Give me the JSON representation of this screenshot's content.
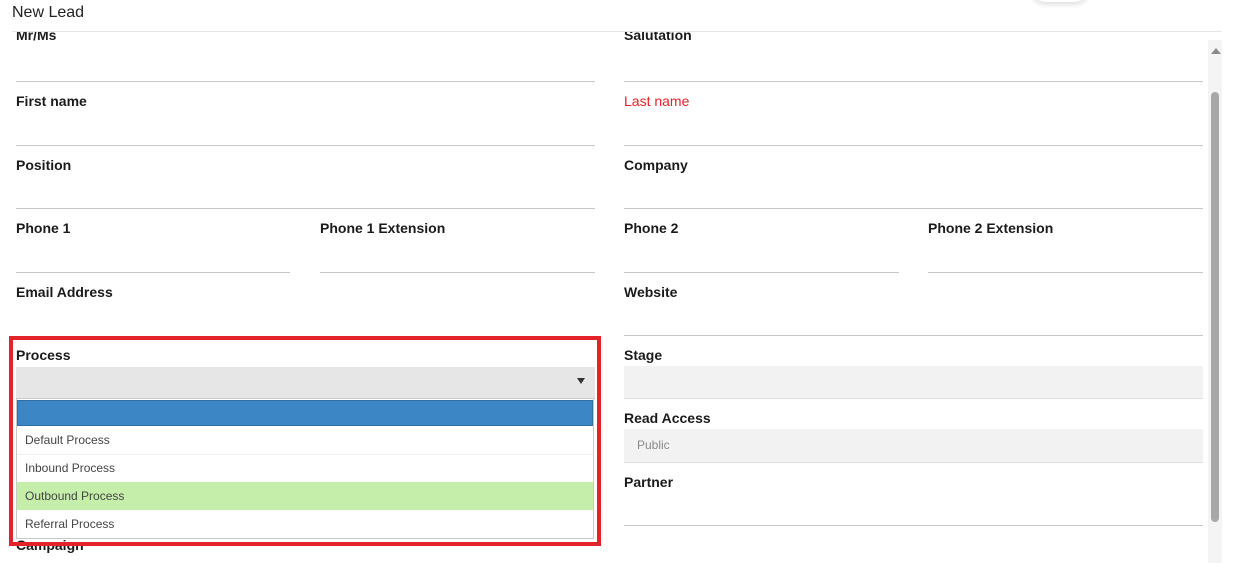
{
  "window": {
    "title": "New Lead"
  },
  "form": {
    "mr_ms_label": "Mr/Ms",
    "salutation_label": "Salutation",
    "first_name_label": "First name",
    "last_name_label": "Last name",
    "position_label": "Position",
    "company_label": "Company",
    "phone1_label": "Phone 1",
    "phone1_ext_label": "Phone 1 Extension",
    "phone2_label": "Phone 2",
    "phone2_ext_label": "Phone 2 Extension",
    "email_label": "Email Address",
    "website_label": "Website",
    "process_label": "Process",
    "stage_label": "Stage",
    "read_access_label": "Read Access",
    "read_access_value": "Public",
    "partner_label": "Partner",
    "campaign_label": "Campaign"
  },
  "process_dropdown": {
    "selected": "",
    "options": [
      "",
      "Default Process",
      "Inbound Process",
      "Outbound Process",
      "Referral Process"
    ],
    "highlighted": "Outbound Process"
  },
  "colors": {
    "required_label": "#e8212b",
    "dropdown_selected": "#3d86c6",
    "dropdown_hover": "#c5eeaa",
    "annotation_border": "#e3222a"
  }
}
